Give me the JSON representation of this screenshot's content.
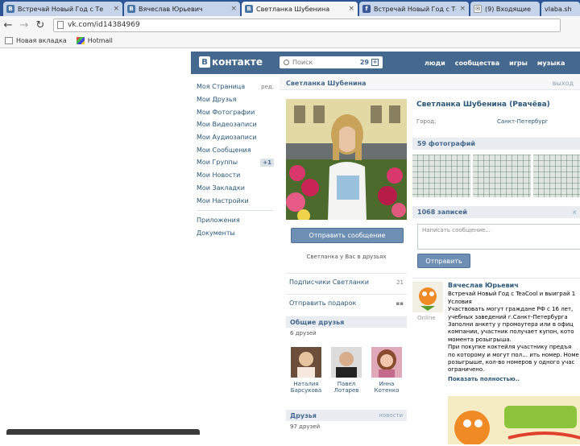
{
  "browser": {
    "tabs": [
      {
        "label": "Встречай Новый Год с Те",
        "icon": "vk-favicon",
        "active": false
      },
      {
        "label": "Вячеслав Юрьевич",
        "icon": "vk-favicon",
        "active": false
      },
      {
        "label": "Светланка Шубенина",
        "icon": "vk-favicon",
        "active": true
      },
      {
        "label": "Встречай Новый Год с Те",
        "icon": "facebook-favicon",
        "active": false
      },
      {
        "label": "(9) Входящие",
        "icon": "mail-favicon",
        "active": false
      },
      {
        "label": "vlaba.sh",
        "icon": "",
        "active": false
      }
    ],
    "close_glyph": "×",
    "url": "vk.com/id14384969",
    "bookmarks": [
      "Новая вкладка",
      "Hotmail"
    ]
  },
  "vk": {
    "logo_text": "контакте",
    "search_placeholder": "Поиск",
    "search_count": "29",
    "nav": [
      "люди",
      "сообщества",
      "игры",
      "музыка"
    ],
    "menu": [
      {
        "label": "Моя Страница",
        "extra": "ред."
      },
      {
        "label": "Мои Друзья",
        "extra": ""
      },
      {
        "label": "Мои Фотографии",
        "extra": ""
      },
      {
        "label": "Мои Видеозаписи",
        "extra": ""
      },
      {
        "label": "Мои Аудиозаписи",
        "extra": ""
      },
      {
        "label": "Мои Сообщения",
        "extra": ""
      },
      {
        "label": "Мои Группы",
        "extra": "+1"
      },
      {
        "label": "Мои Новости",
        "extra": ""
      },
      {
        "label": "Мои Закладки",
        "extra": ""
      },
      {
        "label": "Мои Настройки",
        "extra": ""
      }
    ],
    "menu_extra": [
      "Приложения",
      "Документы"
    ],
    "profile": {
      "title": "Светланка Шубенина",
      "exit": "выход",
      "full_name": "Светланка Шубенина (Рвачёва)",
      "city_label": "Город:",
      "city_value": "Санкт-Петербург",
      "send_message": "Отправить сообщение",
      "friend_status": "Светланка у Вас в друзьях",
      "subscribers": "Подписчики Светланки",
      "subscribers_count": "21",
      "send_gift": "Отправить подарок",
      "mutual_title": "Общие друзья",
      "mutual_count": "6 друзей",
      "mutual": [
        {
          "first": "Наталия",
          "last": "Барсукова"
        },
        {
          "first": "Павел",
          "last": "Лотарев"
        },
        {
          "first": "Инна",
          "last": "Котенко"
        }
      ],
      "friends_title": "Друзья",
      "friends_more": "новости",
      "friends_count": "97 друзей",
      "photos_title": "59 фотографий",
      "wall_title": "1068 записей",
      "wall_more": "к",
      "post_placeholder": "Написать сообщение...",
      "send_btn": "Отправить"
    },
    "post": {
      "author": "Вячеслав Юрьевич",
      "online": "Online",
      "lines": [
        "Встречай Новый Год с TeaCool и выиграй 1",
        "Условия",
        "Участвовать могут граждане РФ с 16 лет,",
        "учебных заведений г.Санкт-Петербурга",
        "Заполни анкету у промоутера или в офиц",
        "компании, участник получает купон, кото",
        "момента розыгрыша.",
        "При покупке коктейля участнику предъя",
        "по которому и могут пол… ить номер. Номе",
        "розыгрыше, кол-во номеров у одного учас",
        "ограничено."
      ],
      "more": "Показать полностью.."
    }
  }
}
